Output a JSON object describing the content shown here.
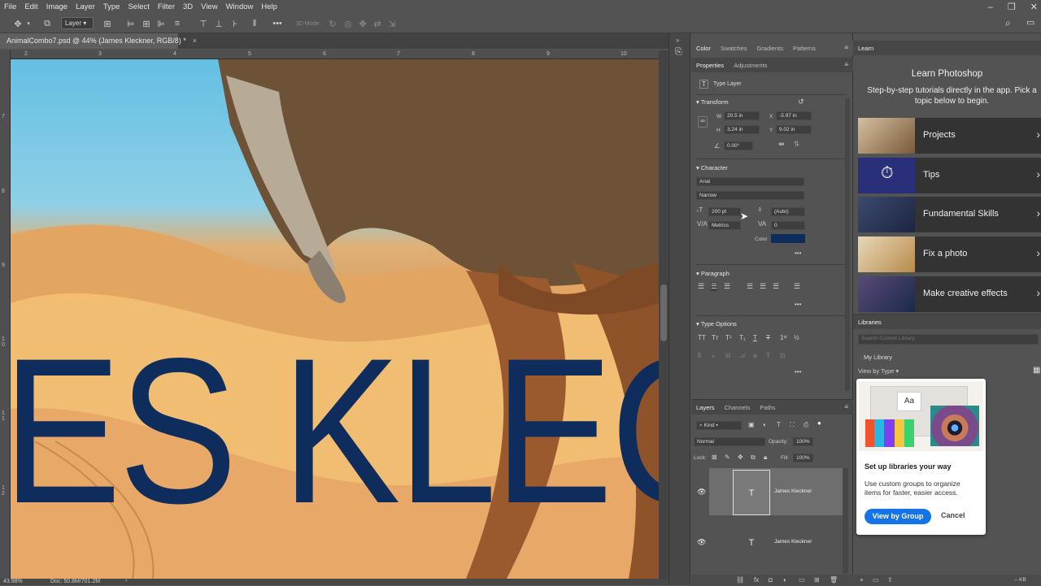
{
  "menubar": {
    "items": [
      "File",
      "Edit",
      "Image",
      "Layer",
      "Type",
      "Select",
      "Filter",
      "3D",
      "View",
      "Window",
      "Help"
    ],
    "window_controls": [
      "–",
      "❐",
      "✕"
    ]
  },
  "options_bar": {
    "auto_select_value": "Layer",
    "mode_3d_label": "3D Mode:",
    "more_label": "•••",
    "search_icon": "search-icon",
    "workspace_icon": "workspace-icon"
  },
  "document": {
    "tab_title": "AnimalCombo7.psd @ 44% (James Kleckner, RGB/8) *",
    "close_label": "×",
    "canvas_text": "ES KLECI",
    "ruler_h_ticks": [
      "2",
      "3",
      "4",
      "5",
      "6",
      "7",
      "8",
      "9",
      "10"
    ],
    "ruler_v_ticks": [
      "7",
      "8",
      "9",
      "1 0",
      "1 1",
      "1 2"
    ],
    "zoom": "43.98%",
    "doc_size": "Doc: 50.8M/701.2M"
  },
  "properties_panel": {
    "top_tabs": [
      "Color",
      "Swatches",
      "Gradients",
      "Patterns"
    ],
    "tabs": [
      "Properties",
      "Adjustments"
    ],
    "layer_type": "Type Layer",
    "transform": {
      "title": "Transform",
      "w_label": "W",
      "w_value": "20.5 in",
      "x_label": "X",
      "x_value": "-3.97 in",
      "h_label": "H",
      "h_value": "3.24 in",
      "y_label": "Y",
      "y_value": "9.02 in",
      "angle_value": "0.00°"
    },
    "character": {
      "title": "Character",
      "font_family": "Arial",
      "font_style": "Narrow",
      "size": "200 pt",
      "leading": "(Auto)",
      "kerning": "Metrics",
      "tracking": "0",
      "color_label": "Color",
      "color": "#0e2d5c"
    },
    "paragraph": {
      "title": "Paragraph"
    },
    "type_options": {
      "title": "Type Options"
    },
    "more": "•••"
  },
  "layers_panel": {
    "tabs": [
      "Layers",
      "Channels",
      "Paths"
    ],
    "filter_kind": "Kind",
    "blend_mode": "Normal",
    "opacity_label": "Opacity:",
    "opacity_value": "100%",
    "lock_label": "Lock:",
    "fill_label": "Fill:",
    "fill_value": "100%",
    "layers": [
      {
        "name": "James Kleckner",
        "thumb": "T",
        "selected": true
      },
      {
        "name": "James Kleckner",
        "thumb": "T",
        "selected": false
      }
    ]
  },
  "learn_panel": {
    "tab": "Learn",
    "title": "Learn Photoshop",
    "subtitle": "Step-by-step tutorials directly in the app. Pick a topic below to begin.",
    "cards": [
      {
        "label": "Projects",
        "color": "#7a5a3a"
      },
      {
        "label": "Tips",
        "color": "#2a2f7a"
      },
      {
        "label": "Fundamental Skills",
        "color": "#1d2540"
      },
      {
        "label": "Fix a photo",
        "color": "#c9b18a"
      },
      {
        "label": "Make creative effects",
        "color": "#3a2d4d"
      }
    ]
  },
  "libraries_panel": {
    "tab": "Libraries",
    "search_placeholder": "Search Current Library",
    "library_name": "My Library",
    "view_by": "View by Type",
    "popup": {
      "thumb_text": "Aa",
      "heading": "Set up libraries your way",
      "body": "Use custom groups to organize items for faster, easier access.",
      "primary_button": "View by Group",
      "secondary_button": "Cancel"
    },
    "footer_size": "-- KB"
  }
}
